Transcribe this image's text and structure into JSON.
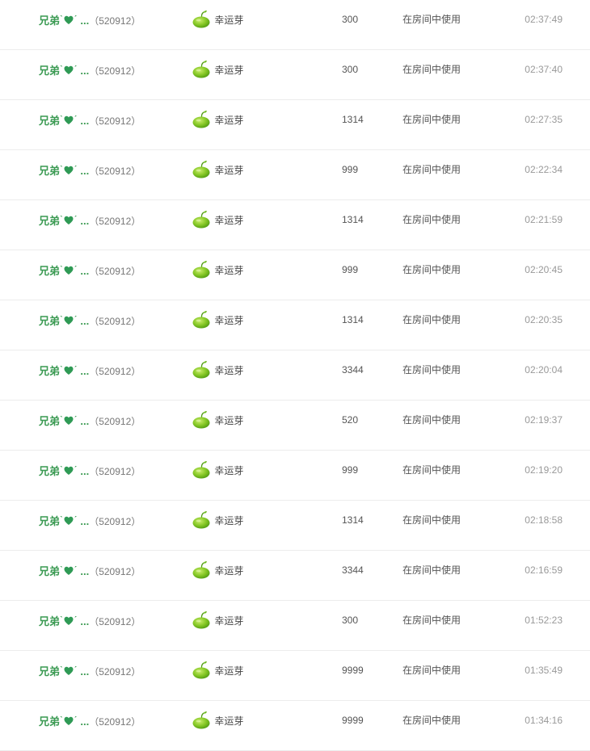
{
  "columns": [
    "user",
    "gift",
    "amount",
    "usage",
    "time"
  ],
  "rows": [
    {
      "user_name": "兄弟",
      "user_deco": "ˋ ˊ",
      "user_ellipsis": "...",
      "user_id": "（520912）",
      "gift": "幸运芽",
      "amount": "300",
      "usage": "在房间中使用",
      "time": "02:37:49"
    },
    {
      "user_name": "兄弟",
      "user_deco": "ˋ ˊ",
      "user_ellipsis": "...",
      "user_id": "（520912）",
      "gift": "幸运芽",
      "amount": "300",
      "usage": "在房间中使用",
      "time": "02:37:40"
    },
    {
      "user_name": "兄弟",
      "user_deco": "ˋ ˊ",
      "user_ellipsis": "...",
      "user_id": "（520912）",
      "gift": "幸运芽",
      "amount": "1314",
      "usage": "在房间中使用",
      "time": "02:27:35"
    },
    {
      "user_name": "兄弟",
      "user_deco": "ˋ ˊ",
      "user_ellipsis": "...",
      "user_id": "（520912）",
      "gift": "幸运芽",
      "amount": "999",
      "usage": "在房间中使用",
      "time": "02:22:34"
    },
    {
      "user_name": "兄弟",
      "user_deco": "ˋ ˊ",
      "user_ellipsis": "...",
      "user_id": "（520912）",
      "gift": "幸运芽",
      "amount": "1314",
      "usage": "在房间中使用",
      "time": "02:21:59"
    },
    {
      "user_name": "兄弟",
      "user_deco": "ˋ ˊ",
      "user_ellipsis": "...",
      "user_id": "（520912）",
      "gift": "幸运芽",
      "amount": "999",
      "usage": "在房间中使用",
      "time": "02:20:45"
    },
    {
      "user_name": "兄弟",
      "user_deco": "ˋ ˊ",
      "user_ellipsis": "...",
      "user_id": "（520912）",
      "gift": "幸运芽",
      "amount": "1314",
      "usage": "在房间中使用",
      "time": "02:20:35"
    },
    {
      "user_name": "兄弟",
      "user_deco": "ˋ ˊ",
      "user_ellipsis": "...",
      "user_id": "（520912）",
      "gift": "幸运芽",
      "amount": "3344",
      "usage": "在房间中使用",
      "time": "02:20:04"
    },
    {
      "user_name": "兄弟",
      "user_deco": "ˋ ˊ",
      "user_ellipsis": "...",
      "user_id": "（520912）",
      "gift": "幸运芽",
      "amount": "520",
      "usage": "在房间中使用",
      "time": "02:19:37"
    },
    {
      "user_name": "兄弟",
      "user_deco": "ˋ ˊ",
      "user_ellipsis": "...",
      "user_id": "（520912）",
      "gift": "幸运芽",
      "amount": "999",
      "usage": "在房间中使用",
      "time": "02:19:20"
    },
    {
      "user_name": "兄弟",
      "user_deco": "ˋ ˊ",
      "user_ellipsis": "...",
      "user_id": "（520912）",
      "gift": "幸运芽",
      "amount": "1314",
      "usage": "在房间中使用",
      "time": "02:18:58"
    },
    {
      "user_name": "兄弟",
      "user_deco": "ˋ ˊ",
      "user_ellipsis": "...",
      "user_id": "（520912）",
      "gift": "幸运芽",
      "amount": "3344",
      "usage": "在房间中使用",
      "time": "02:16:59"
    },
    {
      "user_name": "兄弟",
      "user_deco": "ˋ ˊ",
      "user_ellipsis": "...",
      "user_id": "（520912）",
      "gift": "幸运芽",
      "amount": "300",
      "usage": "在房间中使用",
      "time": "01:52:23"
    },
    {
      "user_name": "兄弟",
      "user_deco": "ˋ ˊ",
      "user_ellipsis": "...",
      "user_id": "（520912）",
      "gift": "幸运芽",
      "amount": "9999",
      "usage": "在房间中使用",
      "time": "01:35:49"
    },
    {
      "user_name": "兄弟",
      "user_deco": "ˋ ˊ",
      "user_ellipsis": "...",
      "user_id": "（520912）",
      "gift": "幸运芽",
      "amount": "9999",
      "usage": "在房间中使用",
      "time": "01:34:16"
    }
  ],
  "icons": {
    "user_heart": "heart-icon",
    "gift": "sprout-bean-icon"
  },
  "colors": {
    "user_name": "#3a9a52",
    "heart": "#2f9a55",
    "bean": "#7dc21e",
    "time": "#999999",
    "row_border": "#ececec"
  }
}
